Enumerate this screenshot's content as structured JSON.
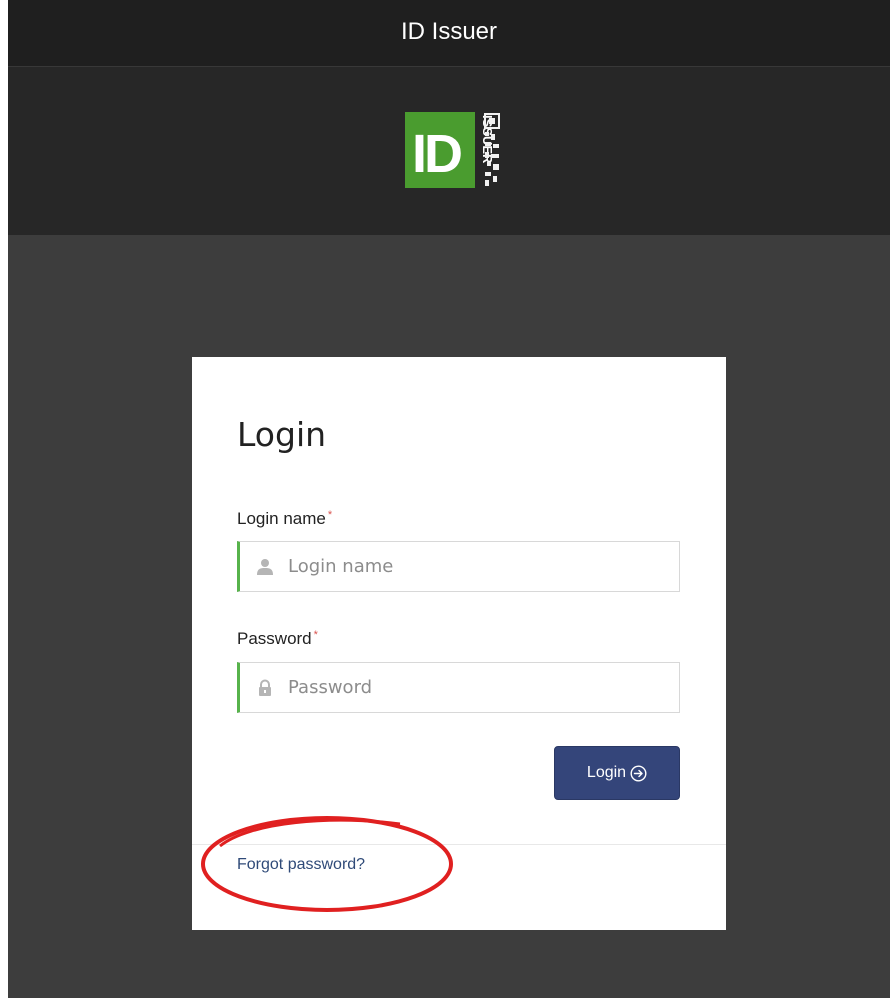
{
  "window": {
    "title": "ID Issuer"
  },
  "logo": {
    "icon": "id-issuer-logo",
    "big_text": "ID",
    "side_text": "ISSUER",
    "color": "#4a9c2f"
  },
  "login": {
    "heading": "Login",
    "username_label": "Login name",
    "username_placeholder": "Login name",
    "username_value": "",
    "password_label": "Password",
    "password_placeholder": "Password",
    "password_value": "",
    "required_marker": "*",
    "submit_label": "Login",
    "forgot_label": "Forgot password?"
  },
  "colors": {
    "button": "#34457a",
    "field_accent": "#57b34b",
    "required": "#d9534f",
    "link": "#2f4a78",
    "annotation": "#e02020"
  }
}
